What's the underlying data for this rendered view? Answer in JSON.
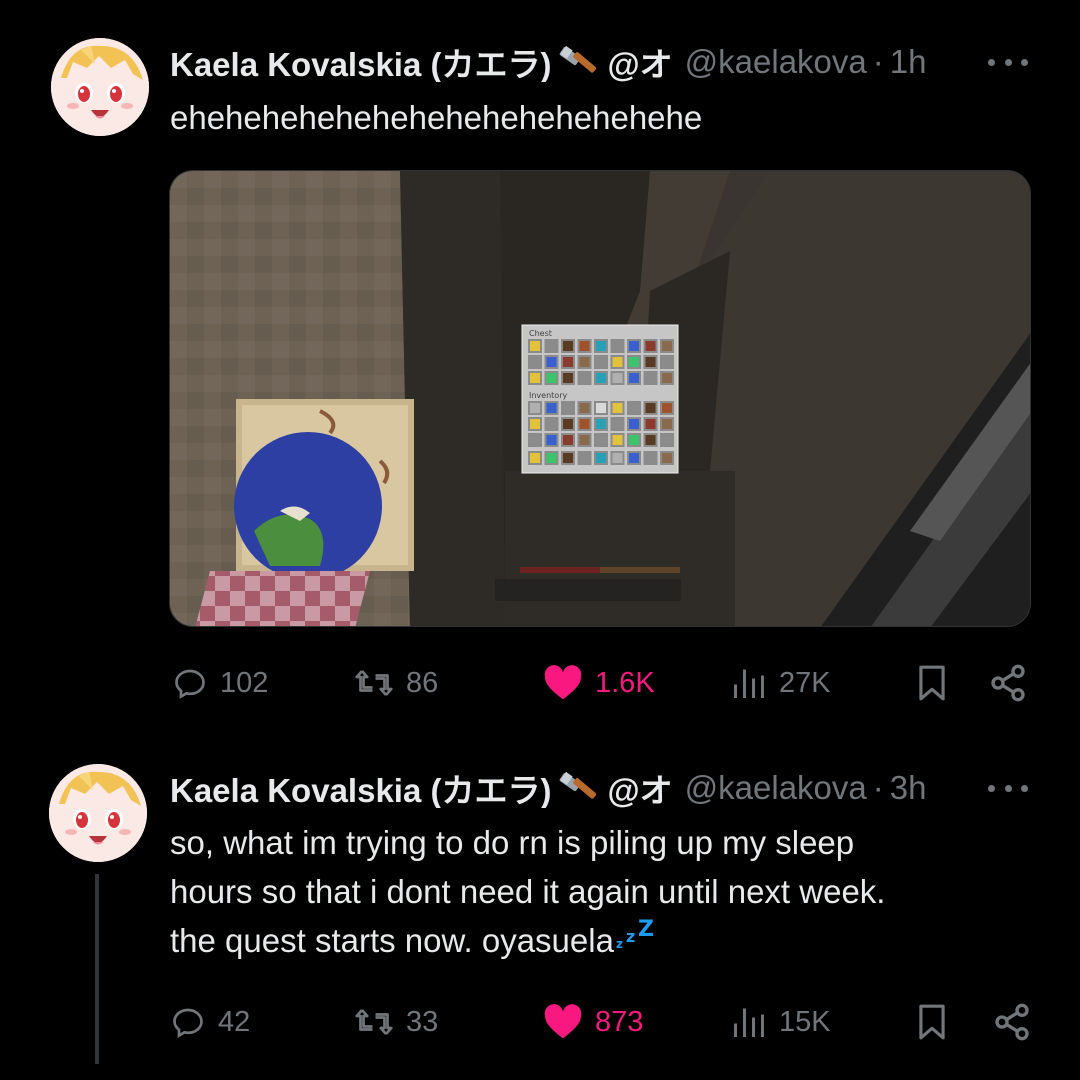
{
  "tweets": [
    {
      "display_name": "Kaela Kovalskia (カエラ)",
      "handle_prefix": "@オ",
      "handle": "@kaelakova",
      "time": "1h",
      "text": "ehehehehehehehehehehehehehehe",
      "actions": {
        "replies": "102",
        "retweets": "86",
        "likes": "1.6K",
        "views": "27K"
      }
    },
    {
      "display_name": "Kaela Kovalskia (カエラ)",
      "handle_prefix": "@オ",
      "handle": "@kaelakova",
      "time": "3h",
      "text_lines": [
        "so, what im trying to do rn is piling up my sleep",
        "hours so that i dont need it again until next week.",
        "the quest starts now. oyasuela"
      ],
      "actions": {
        "replies": "42",
        "retweets": "33",
        "likes": "873",
        "views": "15K"
      }
    }
  ],
  "media": {
    "chest_label": "Chest",
    "inventory_label": "Inventory"
  },
  "colors": {
    "like": "#f91880",
    "muted": "#71767b",
    "text": "#e7e9ea",
    "zz": "#1d9bf0"
  }
}
